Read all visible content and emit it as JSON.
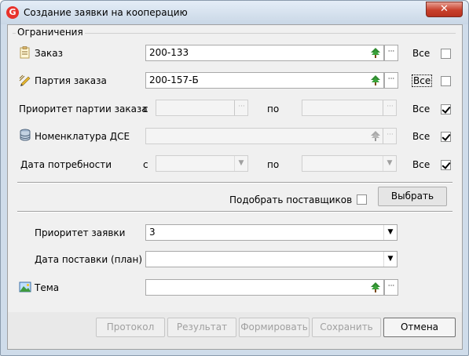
{
  "window": {
    "title": "Создание заявки на кооперацию",
    "app_icon": "G",
    "close_glyph": "✕"
  },
  "restrictions": {
    "section_title": "Ограничения",
    "order": {
      "label": "Заказ",
      "value": "200-133",
      "all_label": "Все",
      "all_checked": false
    },
    "order_batch": {
      "label": "Партия заказа",
      "value": "200-157-Б",
      "all_label": "Все",
      "all_checked": false
    },
    "batch_priority": {
      "label": "Приоритет партии заказа",
      "from_label": "с",
      "to_label": "по",
      "from_value": "",
      "to_value": "",
      "all_label": "Все",
      "all_checked": true
    },
    "nomenclature": {
      "label": "Номенклатура ДСЕ",
      "value": "",
      "all_label": "Все",
      "all_checked": true
    },
    "need_date": {
      "label": "Дата потребности",
      "from_label": "с",
      "to_label": "по",
      "from_value": "",
      "to_value": "",
      "all_label": "Все",
      "all_checked": true
    }
  },
  "suppliers": {
    "label": "Подобрать поставщиков",
    "checked": false,
    "select_button": "Выбрать"
  },
  "request": {
    "priority": {
      "label": "Приоритет заявки",
      "value": "3"
    },
    "delivery_date": {
      "label": "Дата поставки (план)",
      "value": ""
    },
    "topic": {
      "label": "Тема",
      "value": ""
    }
  },
  "buttons": {
    "protocol": "Протокол",
    "result": "Результат",
    "form": "Формировать",
    "save": "Сохранить",
    "cancel": "Отмена"
  },
  "lookup_glyph": "···",
  "dropdown_glyph": "▼",
  "icons": {
    "order": "order-icon",
    "batch": "pencil-icon",
    "nomenclature": "database-icon",
    "topic": "image-icon",
    "tree": "tree-icon"
  }
}
